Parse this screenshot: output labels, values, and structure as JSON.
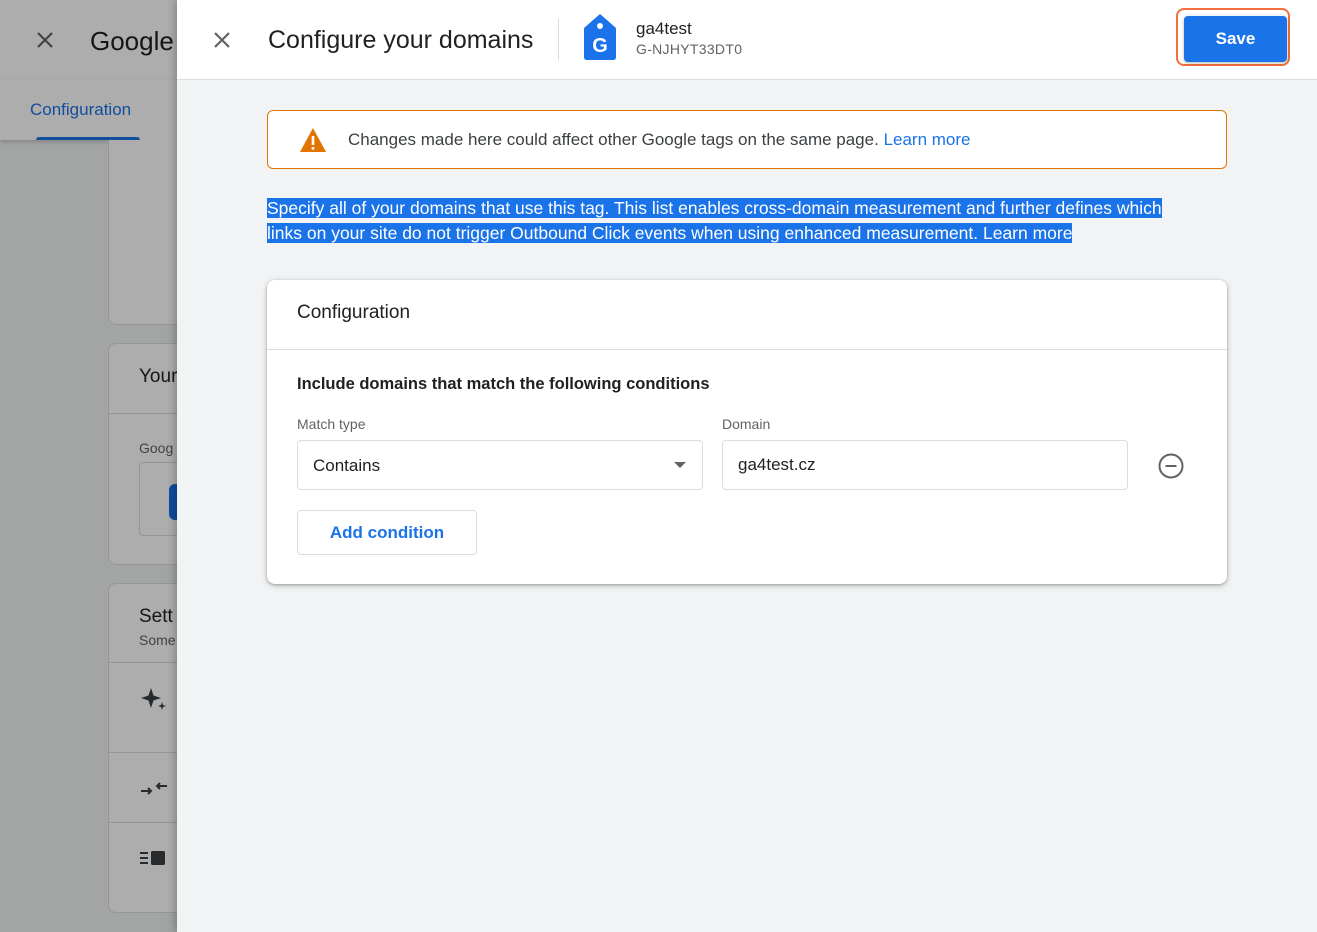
{
  "background": {
    "title": "Google",
    "tab": "Configuration",
    "card2_title": "Your",
    "card2_label": "Goog",
    "card3_title": "Sett",
    "card3_sub": "Some"
  },
  "drawer": {
    "title": "Configure your domains",
    "tag_name": "ga4test",
    "tag_id": "G-NJHYT33DT0",
    "save_label": "Save"
  },
  "warning": {
    "text": "Changes made here could affect other Google tags on the same page.",
    "link": "Learn more"
  },
  "description": {
    "line1": "Specify all of your domains that use this tag. This list enables cross-domain measurement and further defines which",
    "line2": "links on your site do not trigger Outbound Click events when using enhanced measurement.",
    "link": "Learn more"
  },
  "config": {
    "title": "Configuration",
    "conditions_heading": "Include domains that match the following conditions",
    "match_type_label": "Match type",
    "match_type_value": "Contains",
    "domain_label": "Domain",
    "domain_value": "ga4test.cz",
    "add_condition_label": "Add condition"
  },
  "colors": {
    "accent": "#1a73e8",
    "warning": "#e37400",
    "save_highlight": "#f2703b"
  }
}
